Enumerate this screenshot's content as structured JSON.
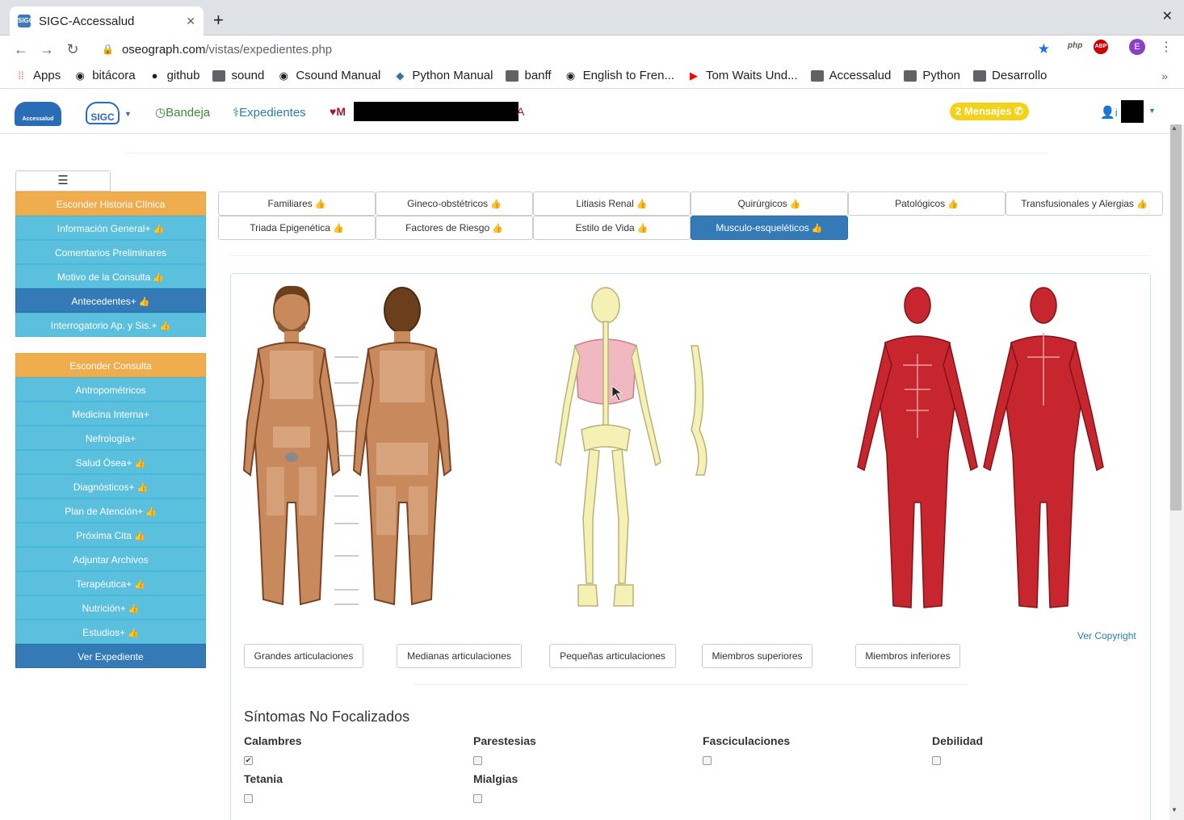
{
  "browser": {
    "tab_title": "SIGC-Accessalud",
    "favicon_text": "SIGC",
    "url_host": "oseograph.com",
    "url_path": "/vistas/expedientes.php",
    "ext_php": "php",
    "ext_abp": "ABP",
    "profile_initial": "E",
    "bookmarks": [
      "Apps",
      "bitácora",
      "github",
      "sound",
      "Csound Manual",
      "Python Manual",
      "banff",
      "English to Fren...",
      "Tom Waits Und...",
      "Accessalud",
      "Python",
      "Desarrollo"
    ]
  },
  "navbar": {
    "logo_text": "Accessalud",
    "sigc_logo": "SIGC",
    "bandeja": "Bandeja",
    "expedientes": "Expedientes",
    "patient_prefix": "M",
    "patient_suffix": "A",
    "messages": "2 Mensajes",
    "user_prefix": "i"
  },
  "sidebar": {
    "items": [
      {
        "label": "Esconder Historia Clínica",
        "style": "orange",
        "thumb": false
      },
      {
        "label": "Información General+",
        "style": "cyan",
        "thumb": true
      },
      {
        "label": "Comentarios Preliminares",
        "style": "cyan",
        "thumb": false
      },
      {
        "label": "Motivo de la Consulta",
        "style": "cyan",
        "thumb": true
      },
      {
        "label": "Antecedentes+",
        "style": "dark",
        "thumb": true
      },
      {
        "label": "Interrogatorio Ap. y Sis.+",
        "style": "cyan",
        "thumb": true
      },
      {
        "label": "Esconder Consulta",
        "style": "orange",
        "thumb": false
      },
      {
        "label": "Antropométricos",
        "style": "cyan",
        "thumb": false
      },
      {
        "label": "Medicina Interna+",
        "style": "cyan",
        "thumb": false
      },
      {
        "label": "Nefrología+",
        "style": "cyan",
        "thumb": false
      },
      {
        "label": "Salud Ósea+",
        "style": "cyan",
        "thumb": true
      },
      {
        "label": "Diagnósticos+",
        "style": "cyan",
        "thumb": true
      },
      {
        "label": "Plan de Atención+",
        "style": "cyan",
        "thumb": true
      },
      {
        "label": "Próxima Cita",
        "style": "cyan",
        "thumb": true
      },
      {
        "label": "Adjuntar Archivos",
        "style": "cyan",
        "thumb": false
      },
      {
        "label": "Terapéutica+",
        "style": "cyan",
        "thumb": true
      },
      {
        "label": "Nutrición+",
        "style": "cyan",
        "thumb": true
      },
      {
        "label": "Estudios+",
        "style": "cyan",
        "thumb": true
      },
      {
        "label": "Ver Expediente",
        "style": "dark",
        "thumb": false
      }
    ]
  },
  "tabs": [
    {
      "label": "Familiares",
      "active": false
    },
    {
      "label": "Gineco-obstétricos",
      "active": false
    },
    {
      "label": "Litiasis Renal",
      "active": false
    },
    {
      "label": "Quirúrgicos",
      "active": false
    },
    {
      "label": "Patológicos",
      "active": false
    },
    {
      "label": "Transfusionales y Alergias",
      "active": false
    },
    {
      "label": "Triada Epigenética",
      "active": false
    },
    {
      "label": "Factores de Riesgo",
      "active": false
    },
    {
      "label": "Estilo de Vida",
      "active": false
    },
    {
      "label": "Musculo-esqueléticos",
      "active": true
    }
  ],
  "panel": {
    "copyright": "Ver Copyright",
    "buttons": [
      "Grandes articulaciones",
      "Medianas articulaciones",
      "Pequeñas articulaciones",
      "Miembros superiores",
      "Miembros inferiores"
    ],
    "section_title": "Síntomas No Focalizados",
    "symptoms": [
      {
        "label": "Calambres",
        "checked": true
      },
      {
        "label": "Parestesias",
        "checked": false
      },
      {
        "label": "Fasciculaciones",
        "checked": false
      },
      {
        "label": "Debilidad",
        "checked": false
      },
      {
        "label": "Tetania",
        "checked": false
      },
      {
        "label": "Mialgias",
        "checked": false
      }
    ]
  },
  "colors": {
    "skin": "#c88a5c",
    "skin_light": "#e2b593",
    "bone": "#f5f1b4",
    "muscle": "#c8262e",
    "primary": "#337ab7",
    "info": "#5bc0de",
    "warning": "#f0ad4e"
  }
}
